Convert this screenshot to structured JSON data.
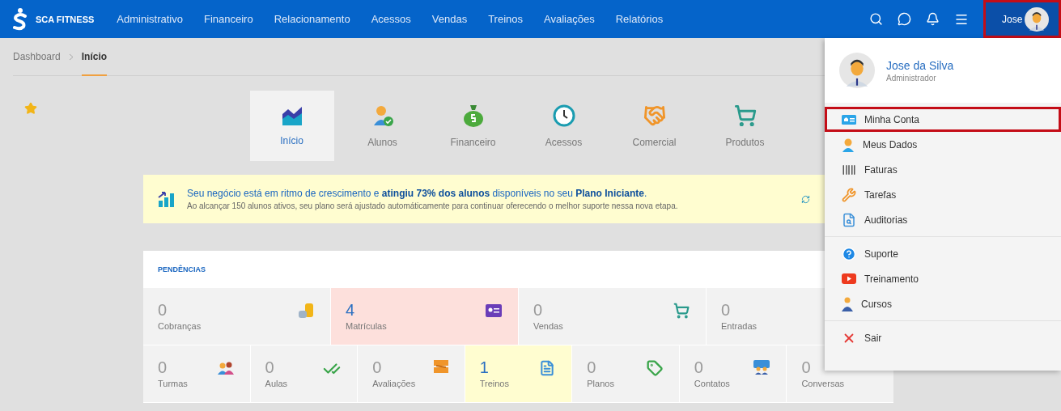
{
  "topbar": {
    "brand": "SCA FITNESS",
    "nav": [
      "Administrativo",
      "Financeiro",
      "Relacionamento",
      "Acessos",
      "Vendas",
      "Treinos",
      "Avaliações",
      "Relatórios"
    ],
    "user": {
      "name": "Jose",
      "highlighted": true
    }
  },
  "breadcrumb": [
    {
      "label": "Dashboard",
      "selected": false
    },
    {
      "label": "Início",
      "selected": true
    }
  ],
  "modules": [
    {
      "label": "Início",
      "selected": true
    },
    {
      "label": "Alunos",
      "selected": false
    },
    {
      "label": "Financeiro",
      "selected": false
    },
    {
      "label": "Acessos",
      "selected": false
    },
    {
      "label": "Comercial",
      "selected": false
    },
    {
      "label": "Produtos",
      "selected": false
    }
  ],
  "banner": {
    "headline": "Seu negócio está em ritmo de crescimento e **atingiu 73% dos alunos** disponíveis no seu **Plano Iniciante**.",
    "detail": "Ao alcançar 150 alunos ativos, seu plano será ajustado automáticamente para continuar oferecendo o melhor suporte nessa nova etapa."
  },
  "pendencias": {
    "title": "PENDÊNCIAS",
    "row_1": [
      {
        "count": "0",
        "label": "Cobranças",
        "color": "#f2f2f2"
      },
      {
        "count": "4",
        "label": "Matrículas",
        "color": "#fde0dc"
      },
      {
        "count": "0",
        "label": "Vendas",
        "color": "#f2f2f2"
      },
      {
        "count": "0",
        "label": "Entradas",
        "color": "#f2f2f2"
      }
    ],
    "row_2": [
      {
        "count": "0",
        "label": "Turmas",
        "color": "#f2f2f2"
      },
      {
        "count": "0",
        "label": "Aulas",
        "color": "#f2f2f2"
      },
      {
        "count": "0",
        "label": "Avaliações",
        "color": "#f2f2f2"
      },
      {
        "count": "1",
        "label": "Treinos",
        "color": "#fffdd0"
      },
      {
        "count": "0",
        "label": "Planos",
        "color": "#f2f2f2"
      },
      {
        "count": "0",
        "label": "Contatos",
        "color": "#f2f2f2"
      },
      {
        "count": "0",
        "label": "Conversas",
        "color": "#f2f2f2"
      }
    ]
  },
  "user_menu": {
    "name": "Jose da Silva",
    "role": "Administrador",
    "groups": [
      {
        "items": [
          {
            "label": "Minha Conta",
            "highlighted": true
          },
          {
            "label": "Meus Dados",
            "highlighted": false
          },
          {
            "label": "Faturas",
            "highlighted": false
          },
          {
            "label": "Tarefas",
            "highlighted": false
          },
          {
            "label": "Auditorias",
            "highlighted": false
          }
        ]
      },
      {
        "items": [
          {
            "label": "Suporte",
            "highlighted": false
          },
          {
            "label": "Treinamento",
            "highlighted": false
          },
          {
            "label": "Cursos",
            "highlighted": false
          }
        ]
      },
      {
        "items": [
          {
            "label": "Sair",
            "highlighted": false
          }
        ]
      }
    ]
  }
}
